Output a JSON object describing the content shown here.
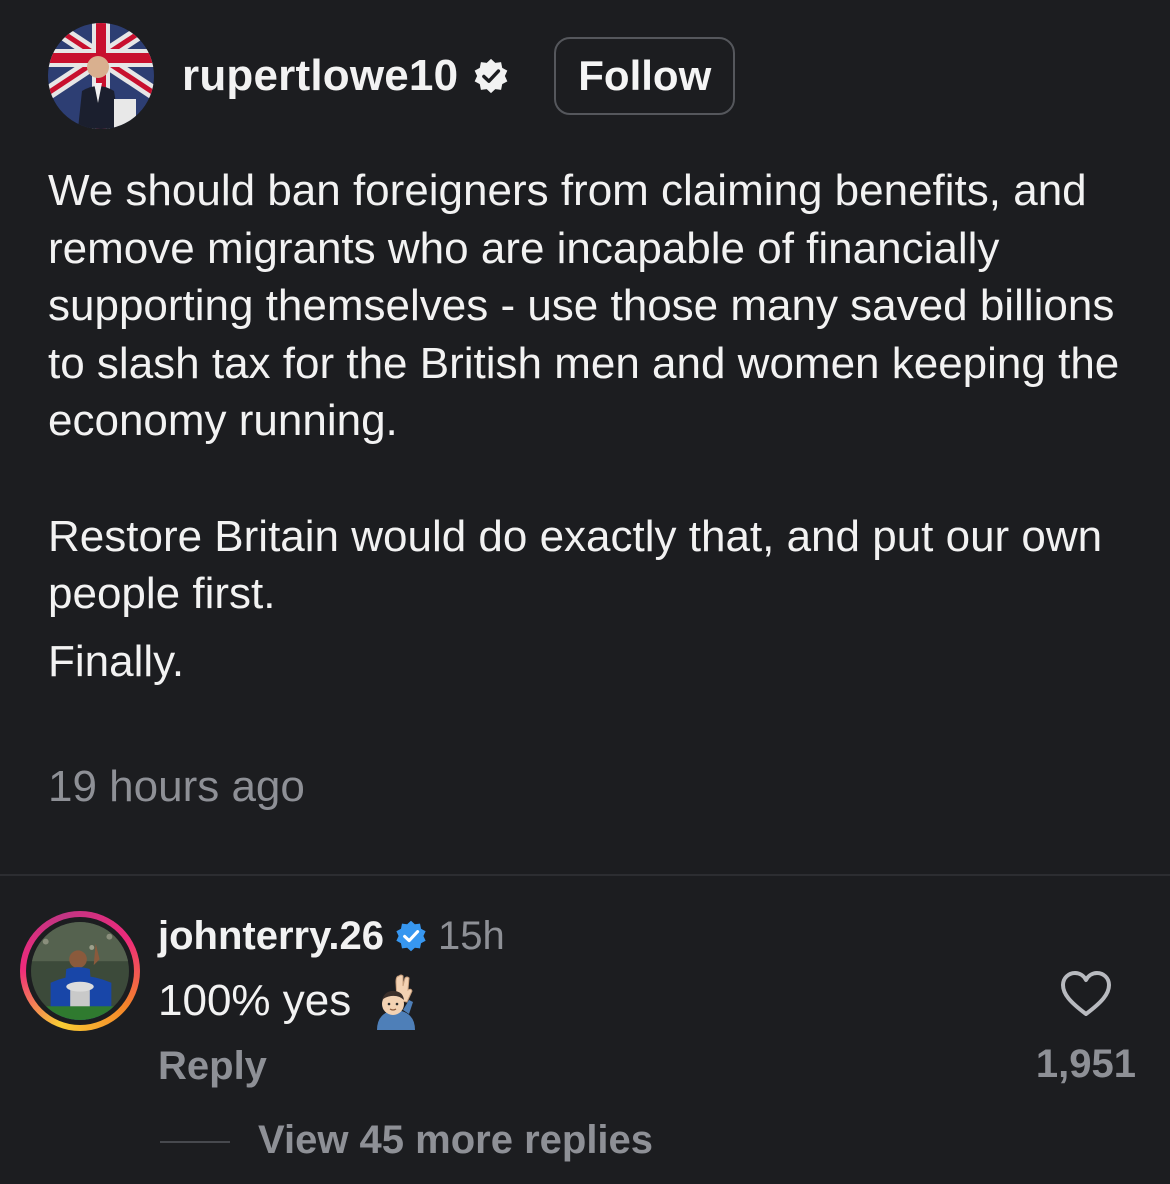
{
  "post": {
    "username": "rupertlowe10",
    "follow_label": "Follow",
    "paragraph_1": "We should ban foreigners from claiming benefits, and remove migrants who are incapable of financially supporting themselves - use those many saved billions to slash tax for the British men and women keeping the economy running.",
    "paragraph_2": "Restore Britain would do exactly that, and put our own people first.",
    "paragraph_3": "Finally.",
    "timestamp": "19 hours ago",
    "verified": true
  },
  "comment": {
    "username": "johnterry.26",
    "time": "15h",
    "text": "100% yes",
    "emoji": "raising-hand-emoji",
    "reply_label": "Reply",
    "like_count": "1,951",
    "view_replies_label": "View 45 more replies",
    "verified": true
  },
  "colors": {
    "background": "#1c1d20",
    "primary_text": "#f2f2f2",
    "secondary_text": "#8e9096",
    "verified_blue": "#3797f0"
  },
  "icons": {
    "verified_main": "verified-badge-icon",
    "verified_comment": "verified-badge-icon",
    "like": "heart-outline-icon"
  }
}
